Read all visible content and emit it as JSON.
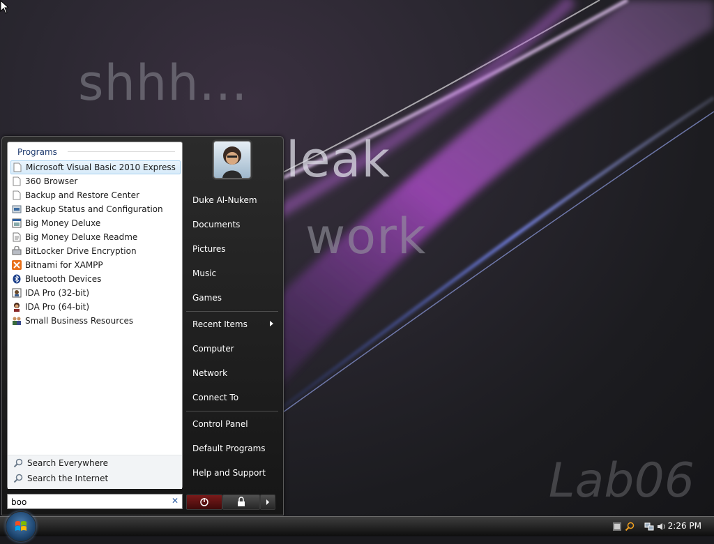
{
  "wallpaper": {
    "line1": "shhh...",
    "line2": "leak",
    "line3": "work",
    "brand": "Lab06"
  },
  "start_menu": {
    "programs_header": "Programs",
    "programs": [
      {
        "label": "Microsoft Visual Basic 2010 Express",
        "icon": "file-icon",
        "selected": true
      },
      {
        "label": "360 Browser",
        "icon": "file-icon",
        "selected": false
      },
      {
        "label": "Backup and Restore Center",
        "icon": "file-icon",
        "selected": false
      },
      {
        "label": "Backup Status and Configuration",
        "icon": "backup-status-icon",
        "selected": false
      },
      {
        "label": "Big Money Deluxe",
        "icon": "app-window-icon",
        "selected": false
      },
      {
        "label": "Big Money Deluxe Readme",
        "icon": "readme-icon",
        "selected": false
      },
      {
        "label": "BitLocker Drive Encryption",
        "icon": "bitlocker-icon",
        "selected": false
      },
      {
        "label": "Bitnami for XAMPP",
        "icon": "xampp-icon",
        "selected": false
      },
      {
        "label": "Bluetooth Devices",
        "icon": "bluetooth-icon",
        "selected": false
      },
      {
        "label": "IDA Pro (32-bit)",
        "icon": "ida-icon",
        "selected": false
      },
      {
        "label": "IDA Pro (64-bit)",
        "icon": "ida-person-icon",
        "selected": false
      },
      {
        "label": "Small Business Resources",
        "icon": "people-icon",
        "selected": false
      }
    ],
    "search_links": [
      {
        "label": "Search Everywhere",
        "icon": "search-icon"
      },
      {
        "label": "Search the Internet",
        "icon": "search-icon"
      }
    ],
    "search_value": "boo",
    "right_items": {
      "user": "Duke Al-Nukem",
      "documents": "Documents",
      "pictures": "Pictures",
      "music": "Music",
      "games": "Games",
      "recent": "Recent Items",
      "computer": "Computer",
      "network": "Network",
      "connect": "Connect To",
      "control_panel": "Control Panel",
      "default_programs": "Default Programs",
      "help": "Help and Support"
    }
  },
  "taskbar": {
    "clock": "2:26 PM"
  },
  "colors": {
    "accent": "#a9d3f2",
    "power": "#7a1a1a"
  }
}
